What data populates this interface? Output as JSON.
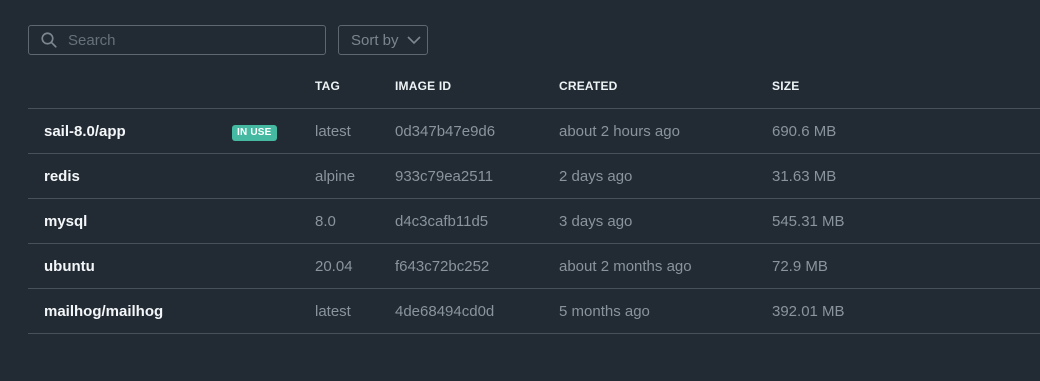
{
  "search": {
    "placeholder": "Search",
    "value": ""
  },
  "sort": {
    "label": "Sort by"
  },
  "table": {
    "columns": {
      "tag": "TAG",
      "image_id": "IMAGE ID",
      "created": "CREATED",
      "size": "SIZE"
    },
    "rows": [
      {
        "name": "sail-8.0/app",
        "badge": "IN USE",
        "tag": "latest",
        "image_id": "0d347b47e9d6",
        "created": "about 2 hours ago",
        "size": "690.6 MB"
      },
      {
        "name": "redis",
        "tag": "alpine",
        "image_id": "933c79ea2511",
        "created": "2 days ago",
        "size": "31.63 MB"
      },
      {
        "name": "mysql",
        "tag": "8.0",
        "image_id": "d4c3cafb11d5",
        "created": "3 days ago",
        "size": "545.31 MB"
      },
      {
        "name": "ubuntu",
        "tag": "20.04",
        "image_id": "f643c72bc252",
        "created": "about 2 months ago",
        "size": "72.9 MB"
      },
      {
        "name": "mailhog/mailhog",
        "tag": "latest",
        "image_id": "4de68494cd0d",
        "created": "5 months ago",
        "size": "392.01 MB"
      }
    ]
  },
  "icons": {
    "search": "search-icon",
    "sort": "chevron-down-icon"
  },
  "colors": {
    "background": "#222b33",
    "badge": "#45b9a1",
    "divider": "#47515a",
    "muted_text": "#8a949d",
    "border": "#5d6770"
  }
}
